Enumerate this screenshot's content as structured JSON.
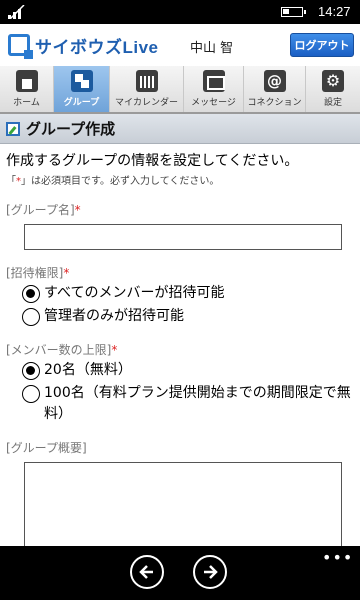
{
  "status": {
    "time": "14:27"
  },
  "header": {
    "logo_text": "サイボウズLive",
    "username": "中山 智",
    "logout_label": "ログアウト"
  },
  "tabs": [
    {
      "label": "ホーム",
      "icon": "home-icon"
    },
    {
      "label": "グループ",
      "icon": "group-icon",
      "active": true
    },
    {
      "label": "マイカレンダー",
      "icon": "calendar-icon"
    },
    {
      "label": "メッセージ",
      "icon": "mail-icon"
    },
    {
      "label": "コネクション",
      "icon": "connection-icon"
    },
    {
      "label": "設定",
      "icon": "settings-icon"
    }
  ],
  "page": {
    "title": "グループ作成",
    "intro": "作成するグループの情報を設定してください。",
    "note_prefix": "「",
    "note_star": "*",
    "note_suffix": "」は必須項目です。必ず入力してください。"
  },
  "form": {
    "group_name": {
      "label": "[グループ名]",
      "required": "*",
      "value": ""
    },
    "invite": {
      "label": "[招待権限]",
      "required": "*",
      "options": [
        {
          "label": "すべてのメンバーが招待可能",
          "checked": true
        },
        {
          "label": "管理者のみが招待可能",
          "checked": false
        }
      ]
    },
    "member_limit": {
      "label": "[メンバー数の上限]",
      "required": "*",
      "options": [
        {
          "label": "20名（無料）",
          "checked": true
        },
        {
          "label": "100名（有料プラン提供開始までの期間限定で無料）",
          "checked": false
        }
      ]
    },
    "summary": {
      "label": "[グループ概要]",
      "value": ""
    }
  },
  "appbar": {
    "more": "•••"
  }
}
